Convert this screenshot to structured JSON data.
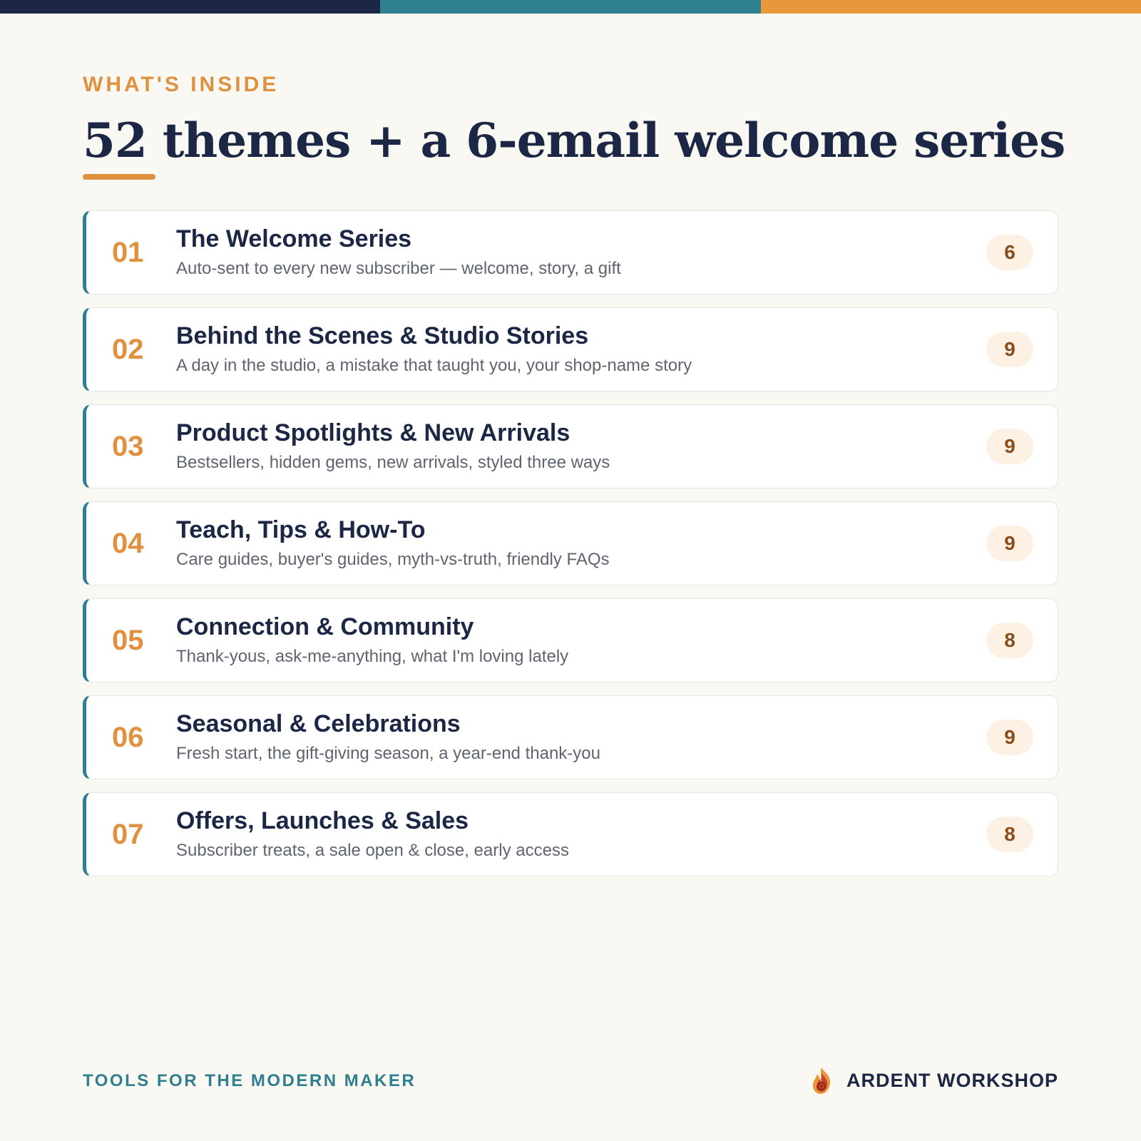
{
  "colors": {
    "navy": "#1b2745",
    "teal": "#2e7f8f",
    "orange": "#e8973a",
    "background": "#faf8f2"
  },
  "header": {
    "eyebrow": "WHAT'S INSIDE",
    "title": "52 themes + a 6-email welcome series"
  },
  "themes": [
    {
      "num": "01",
      "title": "The Welcome Series",
      "desc": "Auto-sent to every new subscriber — welcome, story, a gift",
      "count": "6"
    },
    {
      "num": "02",
      "title": "Behind the Scenes & Studio Stories",
      "desc": "A day in the studio, a mistake that taught you, your shop-name story",
      "count": "9"
    },
    {
      "num": "03",
      "title": "Product Spotlights & New Arrivals",
      "desc": "Bestsellers, hidden gems, new arrivals, styled three ways",
      "count": "9"
    },
    {
      "num": "04",
      "title": "Teach, Tips & How-To",
      "desc": "Care guides, buyer's guides, myth-vs-truth, friendly FAQs",
      "count": "9"
    },
    {
      "num": "05",
      "title": "Connection & Community",
      "desc": "Thank-yous, ask-me-anything, what I'm loving lately",
      "count": "8"
    },
    {
      "num": "06",
      "title": "Seasonal & Celebrations",
      "desc": "Fresh start, the gift-giving season, a year-end thank-you",
      "count": "9"
    },
    {
      "num": "07",
      "title": "Offers, Launches & Sales",
      "desc": "Subscriber treats, a sale open & close, early access",
      "count": "8"
    }
  ],
  "footer": {
    "tagline": "TOOLS FOR THE MODERN MAKER",
    "brand_name": "ARDENT WORKSHOP",
    "brand_icon": "flame-gear-icon"
  }
}
